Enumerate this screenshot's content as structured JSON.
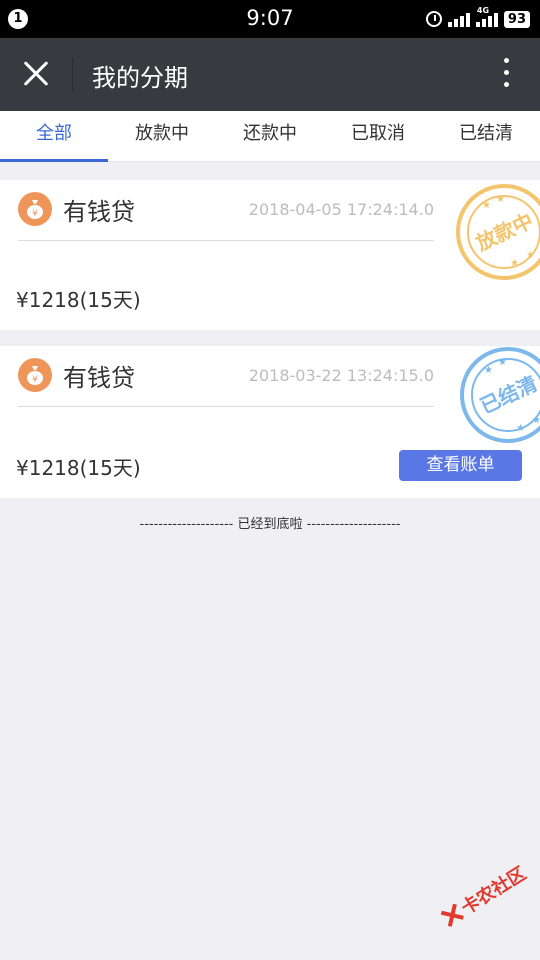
{
  "status_bar": {
    "notification_count": "1",
    "time": "9:07",
    "network_label": "4G",
    "battery": "93",
    "icons": [
      "notification-badge-icon",
      "alarm-icon",
      "signal-icon",
      "battery-icon"
    ]
  },
  "header": {
    "title": "我的分期",
    "close_icon": "close-icon",
    "more_icon": "more-vertical-icon"
  },
  "tabs": [
    {
      "label": "全部",
      "active": true
    },
    {
      "label": "放款中",
      "active": false
    },
    {
      "label": "还款中",
      "active": false
    },
    {
      "label": "已取消",
      "active": false
    },
    {
      "label": "已结清",
      "active": false
    }
  ],
  "loans": [
    {
      "name": "有钱贷",
      "time": "2018-04-05 17:24:14.0",
      "amount": "¥1218(15天)",
      "stamp": "放款中",
      "stamp_color": "#f3c46c"
    },
    {
      "name": "有钱贷",
      "time": "2018-03-22 13:24:15.0",
      "amount": "¥1218(15天)",
      "stamp": "已结清",
      "stamp_color": "#7cb8ec",
      "button": "查看账单"
    }
  ],
  "footer": {
    "end_note": "-------------------- 已经到底啦 --------------------"
  },
  "watermark": "卡农社区",
  "colors": {
    "accent": "#3b6ad6",
    "titlebar": "#393a3f",
    "button": "#5978e6",
    "logo": "#f0955a"
  }
}
